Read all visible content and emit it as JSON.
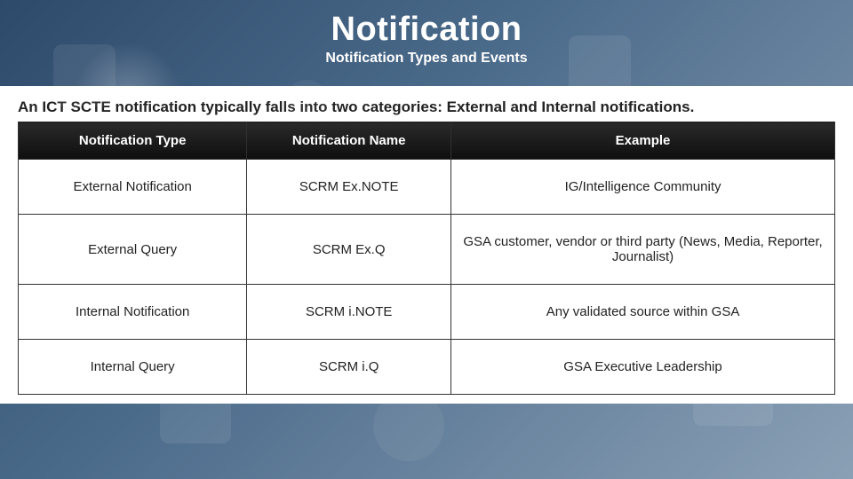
{
  "header": {
    "title": "Notification",
    "subtitle": "Notification Types and Events"
  },
  "intro": "An ICT SCTE notification typically falls into two categories: External and Internal notifications.",
  "table": {
    "headers": [
      "Notification Type",
      "Notification Name",
      "Example"
    ],
    "rows": [
      {
        "type": "External Notification",
        "name": "SCRM Ex.NOTE",
        "example": "IG/Intelligence Community"
      },
      {
        "type": "External Query",
        "name": "SCRM Ex.Q",
        "example": "GSA customer, vendor or third party (News, Media, Reporter, Journalist)"
      },
      {
        "type": "Internal Notification",
        "name": "SCRM i.NOTE",
        "example": "Any validated source within GSA"
      },
      {
        "type": "Internal Query",
        "name": "SCRM i.Q",
        "example": "GSA Executive Leadership"
      }
    ]
  }
}
